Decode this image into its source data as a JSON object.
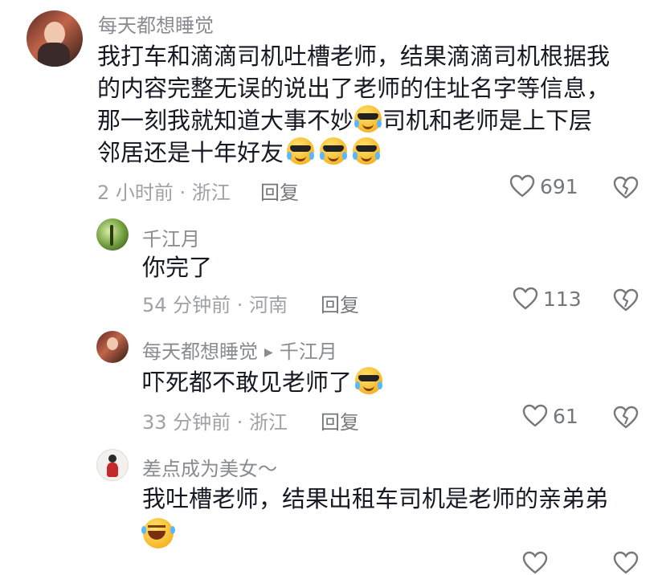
{
  "comments": [
    {
      "username": "每天都想睡觉",
      "text_lines": [
        "我打车和滴滴司机吐槽老师，结果滴滴司机根据我",
        "的内容完整无误的说出了老师的住址名字等信息，",
        "那一刻我就知道大事不妙",
        "司机和老师是上下层",
        "邻居还是十年好友"
      ],
      "time": "2 小时前",
      "location": "浙江",
      "reply_label": "回复",
      "likes": "691"
    },
    {
      "username": "千江月",
      "text": "你完了",
      "time": "54 分钟前",
      "location": "河南",
      "reply_label": "回复",
      "likes": "113"
    },
    {
      "username": "每天都想睡觉",
      "reply_to": "千江月",
      "text": "吓死都不敢见老师了",
      "time": "33 分钟前",
      "location": "浙江",
      "reply_label": "回复",
      "likes": "61"
    },
    {
      "username": "差点成为美女～",
      "text": "我吐槽老师，结果出租车司机是老师的亲弟弟"
    }
  ],
  "meta_separator": " · ",
  "icons": {
    "like": "heart-outline-icon",
    "dislike": "broken-heart-icon",
    "emoji_cool": "cool-sweat-emoji",
    "emoji_laugh": "laughing-emoji"
  },
  "colors": {
    "text": "#161823",
    "secondary": "#8a8b91",
    "meta": "#a0a1a6",
    "icon": "#76777c"
  }
}
